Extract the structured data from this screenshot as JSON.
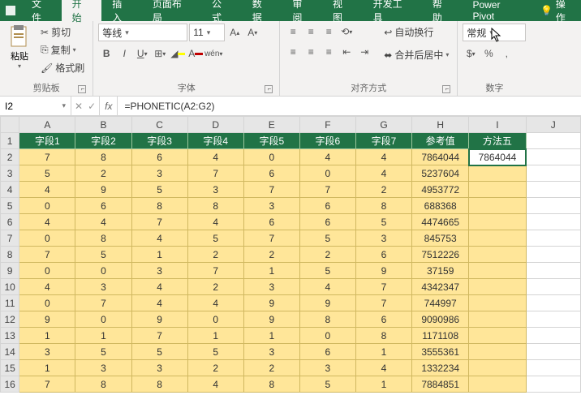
{
  "tabs": {
    "file": "文件",
    "home": "开始",
    "insert": "插入",
    "layout": "页面布局",
    "formula": "公式",
    "data": "数据",
    "review": "审阅",
    "view": "视图",
    "dev": "开发工具",
    "help": "帮助",
    "pivot": "Power Pivot",
    "op_prefix": "操作"
  },
  "clipboard": {
    "cut": "剪切",
    "copy": "复制",
    "fmt": "格式刷",
    "paste": "粘贴",
    "label": "剪贴板"
  },
  "font": {
    "name": "等线",
    "size": "11",
    "label": "字体"
  },
  "align": {
    "wrap": "自动换行",
    "merge": "合并后居中",
    "label": "对齐方式"
  },
  "number": {
    "fmt": "常规",
    "pct": "%",
    "comma": ",",
    "label": "数字"
  },
  "namebox": "I2",
  "formula": "=PHONETIC(A2:G2)",
  "columns": [
    "A",
    "B",
    "C",
    "D",
    "E",
    "F",
    "G",
    "H",
    "I",
    "J"
  ],
  "headers": [
    "字段1",
    "字段2",
    "字段3",
    "字段4",
    "字段5",
    "字段6",
    "字段7",
    "参考值",
    "方法五"
  ],
  "chart_data": {
    "type": "table",
    "title": "",
    "columns": [
      "字段1",
      "字段2",
      "字段3",
      "字段4",
      "字段5",
      "字段6",
      "字段7",
      "参考值",
      "方法五"
    ],
    "rows": [
      [
        "7",
        "8",
        "6",
        "4",
        "0",
        "4",
        "4",
        "7864044",
        "7864044"
      ],
      [
        "5",
        "2",
        "3",
        "7",
        "6",
        "0",
        "4",
        "5237604",
        ""
      ],
      [
        "4",
        "9",
        "5",
        "3",
        "7",
        "7",
        "2",
        "4953772",
        ""
      ],
      [
        "0",
        "6",
        "8",
        "8",
        "3",
        "6",
        "8",
        "688368",
        ""
      ],
      [
        "4",
        "4",
        "7",
        "4",
        "6",
        "6",
        "5",
        "4474665",
        ""
      ],
      [
        "0",
        "8",
        "4",
        "5",
        "7",
        "5",
        "3",
        "845753",
        ""
      ],
      [
        "7",
        "5",
        "1",
        "2",
        "2",
        "2",
        "6",
        "7512226",
        ""
      ],
      [
        "0",
        "0",
        "3",
        "7",
        "1",
        "5",
        "9",
        "37159",
        ""
      ],
      [
        "4",
        "3",
        "4",
        "2",
        "3",
        "4",
        "7",
        "4342347",
        ""
      ],
      [
        "0",
        "7",
        "4",
        "4",
        "9",
        "9",
        "7",
        "744997",
        ""
      ],
      [
        "9",
        "0",
        "9",
        "0",
        "9",
        "8",
        "6",
        "9090986",
        ""
      ],
      [
        "1",
        "1",
        "7",
        "1",
        "1",
        "0",
        "8",
        "1171108",
        ""
      ],
      [
        "3",
        "5",
        "5",
        "5",
        "3",
        "6",
        "1",
        "3555361",
        ""
      ],
      [
        "1",
        "3",
        "3",
        "2",
        "2",
        "3",
        "4",
        "1332234",
        ""
      ],
      [
        "7",
        "8",
        "8",
        "4",
        "8",
        "5",
        "1",
        "7884851",
        ""
      ]
    ]
  }
}
